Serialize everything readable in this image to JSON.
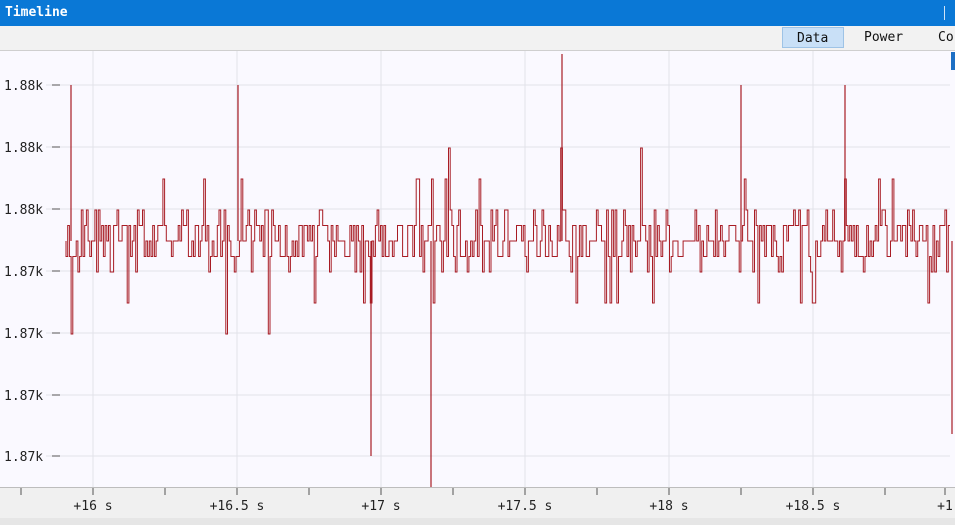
{
  "window": {
    "title": "Timeline"
  },
  "tabs": [
    {
      "label": "Data",
      "active": true
    },
    {
      "label": "Power",
      "active": false
    },
    {
      "label": "Co",
      "active": false
    }
  ],
  "colors": {
    "title_bar": "#0a78d6",
    "signal": "#a81c24",
    "grid": "#e2e2ea",
    "plot_background": "#faf9ff"
  },
  "chart_data": {
    "type": "line",
    "series": [],
    "x_unit": "s",
    "x_tick_labels": [
      "+16 s",
      "+16.5 s",
      "+17 s",
      "+17.5 s",
      "+18 s",
      "+18.5 s",
      "+1"
    ],
    "x_range": [
      15.93,
      18.96
    ],
    "y_tick_labels": [
      "1.88k",
      "1.88k",
      "1.88k",
      "1.87k",
      "1.87k",
      "1.87k",
      "1.87k"
    ],
    "grid": true,
    "signal_description_levels": [
      1875.0,
      1874.5,
      1874.0,
      1873.5,
      1873.0,
      1872.5,
      1872.0
    ],
    "nominal_value": 1873.5
  }
}
